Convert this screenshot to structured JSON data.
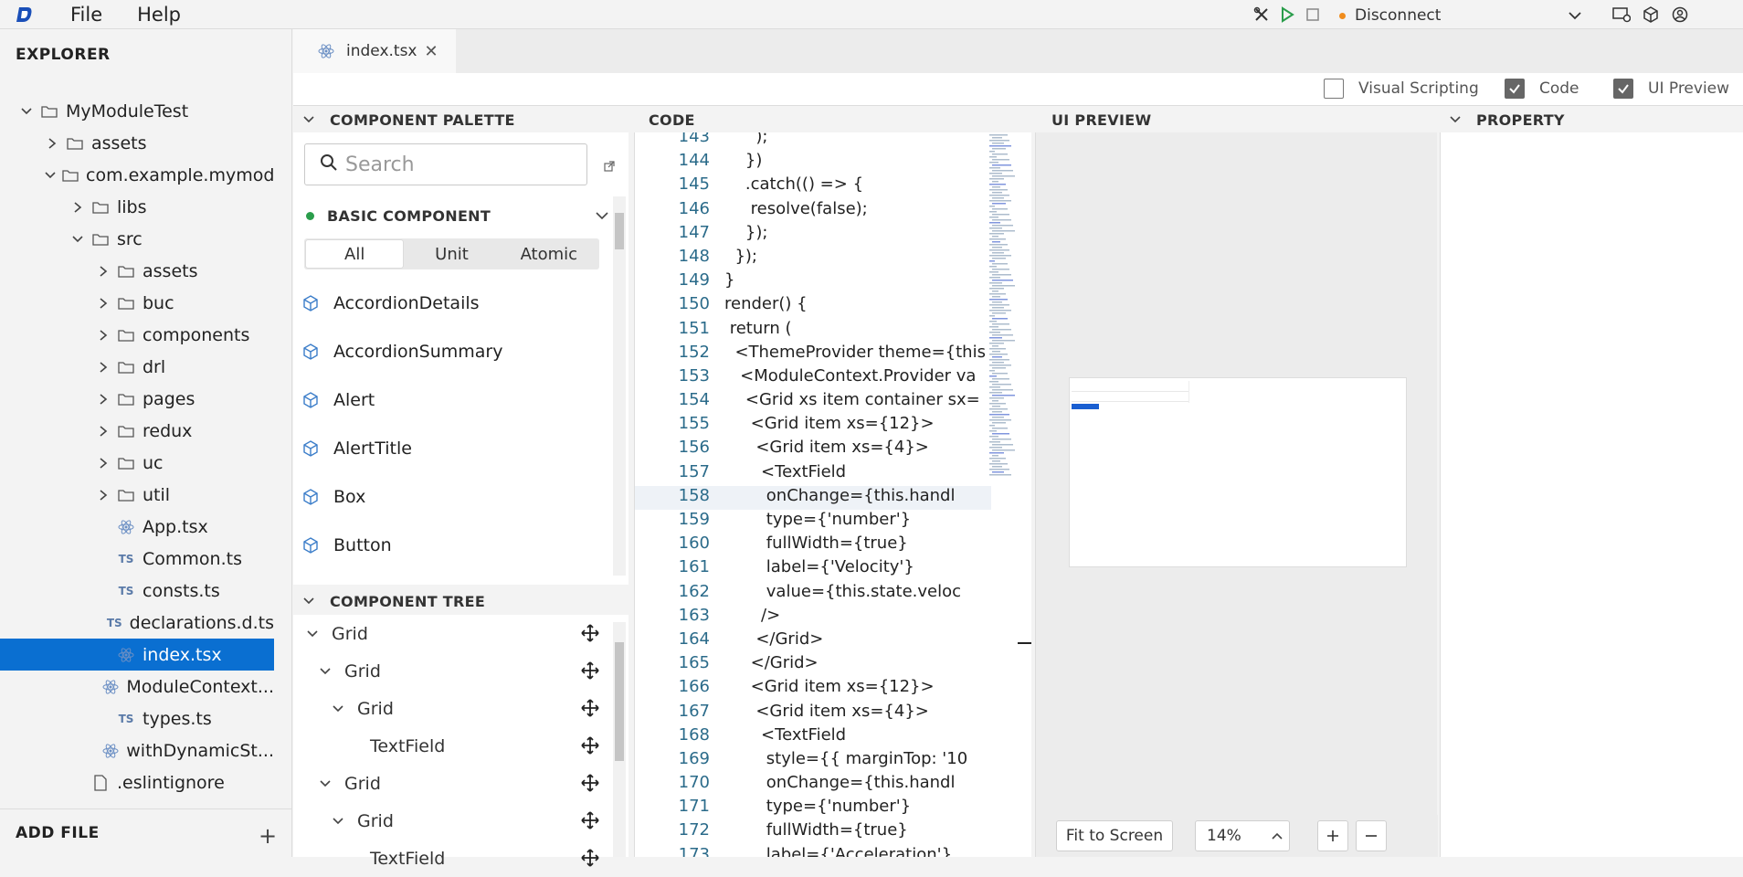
{
  "menu": {
    "file": "File",
    "help": "Help"
  },
  "connection": {
    "label": "Disconnect"
  },
  "explorer": {
    "title": "EXPLORER",
    "items": [
      {
        "label": "MyModuleTest",
        "depth": 0,
        "type": "folder",
        "expanded": true
      },
      {
        "label": "assets",
        "depth": 1,
        "type": "folder",
        "expanded": false
      },
      {
        "label": "com.example.mymod...",
        "depth": 1,
        "type": "folder",
        "expanded": true
      },
      {
        "label": "libs",
        "depth": 2,
        "type": "folder",
        "expanded": false
      },
      {
        "label": "src",
        "depth": 2,
        "type": "folder",
        "expanded": true
      },
      {
        "label": "assets",
        "depth": 3,
        "type": "folder",
        "expanded": false
      },
      {
        "label": "buc",
        "depth": 3,
        "type": "folder",
        "expanded": false
      },
      {
        "label": "components",
        "depth": 3,
        "type": "folder",
        "expanded": false
      },
      {
        "label": "drl",
        "depth": 3,
        "type": "folder",
        "expanded": false
      },
      {
        "label": "pages",
        "depth": 3,
        "type": "folder",
        "expanded": false
      },
      {
        "label": "redux",
        "depth": 3,
        "type": "folder",
        "expanded": false
      },
      {
        "label": "uc",
        "depth": 3,
        "type": "folder",
        "expanded": false
      },
      {
        "label": "util",
        "depth": 3,
        "type": "folder",
        "expanded": false
      },
      {
        "label": "App.tsx",
        "depth": 3,
        "type": "react"
      },
      {
        "label": "Common.ts",
        "depth": 3,
        "type": "ts"
      },
      {
        "label": "consts.ts",
        "depth": 3,
        "type": "ts"
      },
      {
        "label": "declarations.d.ts",
        "depth": 3,
        "type": "ts"
      },
      {
        "label": "index.tsx",
        "depth": 3,
        "type": "react",
        "selected": true
      },
      {
        "label": "ModuleContext...",
        "depth": 3,
        "type": "react"
      },
      {
        "label": "types.ts",
        "depth": 3,
        "type": "ts"
      },
      {
        "label": "withDynamicSt...",
        "depth": 3,
        "type": "react"
      },
      {
        "label": ".eslintignore",
        "depth": 2,
        "type": "file"
      }
    ],
    "add_file": "ADD FILE"
  },
  "tab": {
    "label": "index.tsx"
  },
  "toggles": [
    {
      "label": "Visual Scripting",
      "checked": false
    },
    {
      "label": "Code",
      "checked": true
    },
    {
      "label": "UI Preview",
      "checked": true
    }
  ],
  "palette": {
    "title": "COMPONENT PALETTE",
    "search_placeholder": "Search",
    "group": "BASIC COMPONENT",
    "filters": [
      "All",
      "Unit",
      "Atomic"
    ],
    "components": [
      "AccordionDetails",
      "AccordionSummary",
      "Alert",
      "AlertTitle",
      "Box",
      "Button"
    ]
  },
  "component_tree": {
    "title": "COMPONENT TREE",
    "nodes": [
      {
        "label": "Grid",
        "depth": 0,
        "caret": true
      },
      {
        "label": "Grid",
        "depth": 1,
        "caret": true
      },
      {
        "label": "Grid",
        "depth": 2,
        "caret": true
      },
      {
        "label": "TextField",
        "depth": 3,
        "caret": false
      },
      {
        "label": "Grid",
        "depth": 1,
        "caret": true
      },
      {
        "label": "Grid",
        "depth": 2,
        "caret": true
      },
      {
        "label": "TextField",
        "depth": 3,
        "caret": false
      }
    ]
  },
  "code": {
    "title": "CODE",
    "lines": [
      {
        "n": "143",
        "t": "      );"
      },
      {
        "n": "144",
        "t": "    })"
      },
      {
        "n": "145",
        "t": "    .catch(() => {"
      },
      {
        "n": "146",
        "t": "     resolve(false);"
      },
      {
        "n": "147",
        "t": "    });"
      },
      {
        "n": "148",
        "t": "  });"
      },
      {
        "n": "149",
        "t": "}"
      },
      {
        "n": "150",
        "t": "render() {"
      },
      {
        "n": "151",
        "t": " return ("
      },
      {
        "n": "152",
        "t": "  <ThemeProvider theme={this"
      },
      {
        "n": "153",
        "t": "   <ModuleContext.Provider va"
      },
      {
        "n": "154",
        "t": "    <Grid xs item container sx="
      },
      {
        "n": "155",
        "t": "     <Grid item xs={12}>"
      },
      {
        "n": "156",
        "t": "      <Grid item xs={4}>"
      },
      {
        "n": "157",
        "t": "       <TextField"
      },
      {
        "n": "158",
        "t": "        onChange={this.handl"
      },
      {
        "n": "159",
        "t": "        type={'number'}"
      },
      {
        "n": "160",
        "t": "        fullWidth={true}"
      },
      {
        "n": "161",
        "t": "        label={'Velocity'}"
      },
      {
        "n": "162",
        "t": "        value={this.state.veloc"
      },
      {
        "n": "163",
        "t": "       />"
      },
      {
        "n": "164",
        "t": "      </Grid>"
      },
      {
        "n": "165",
        "t": "     </Grid>"
      },
      {
        "n": "166",
        "t": "     <Grid item xs={12}>"
      },
      {
        "n": "167",
        "t": "      <Grid item xs={4}>"
      },
      {
        "n": "168",
        "t": "       <TextField"
      },
      {
        "n": "169",
        "t": "        style={{ marginTop: '10"
      },
      {
        "n": "170",
        "t": "        onChange={this.handl"
      },
      {
        "n": "171",
        "t": "        type={'number'}"
      },
      {
        "n": "172",
        "t": "        fullWidth={true}"
      },
      {
        "n": "173",
        "t": "        label={'Acceleration'}"
      }
    ]
  },
  "preview": {
    "title": "UI PREVIEW",
    "fit_label": "Fit to Screen",
    "zoom": "14%"
  },
  "property": {
    "title": "PROPERTY"
  },
  "colors": {
    "accent": "#0a6fd1",
    "status_dot": "#f08c1c",
    "group_dot": "#2a9d4b"
  }
}
